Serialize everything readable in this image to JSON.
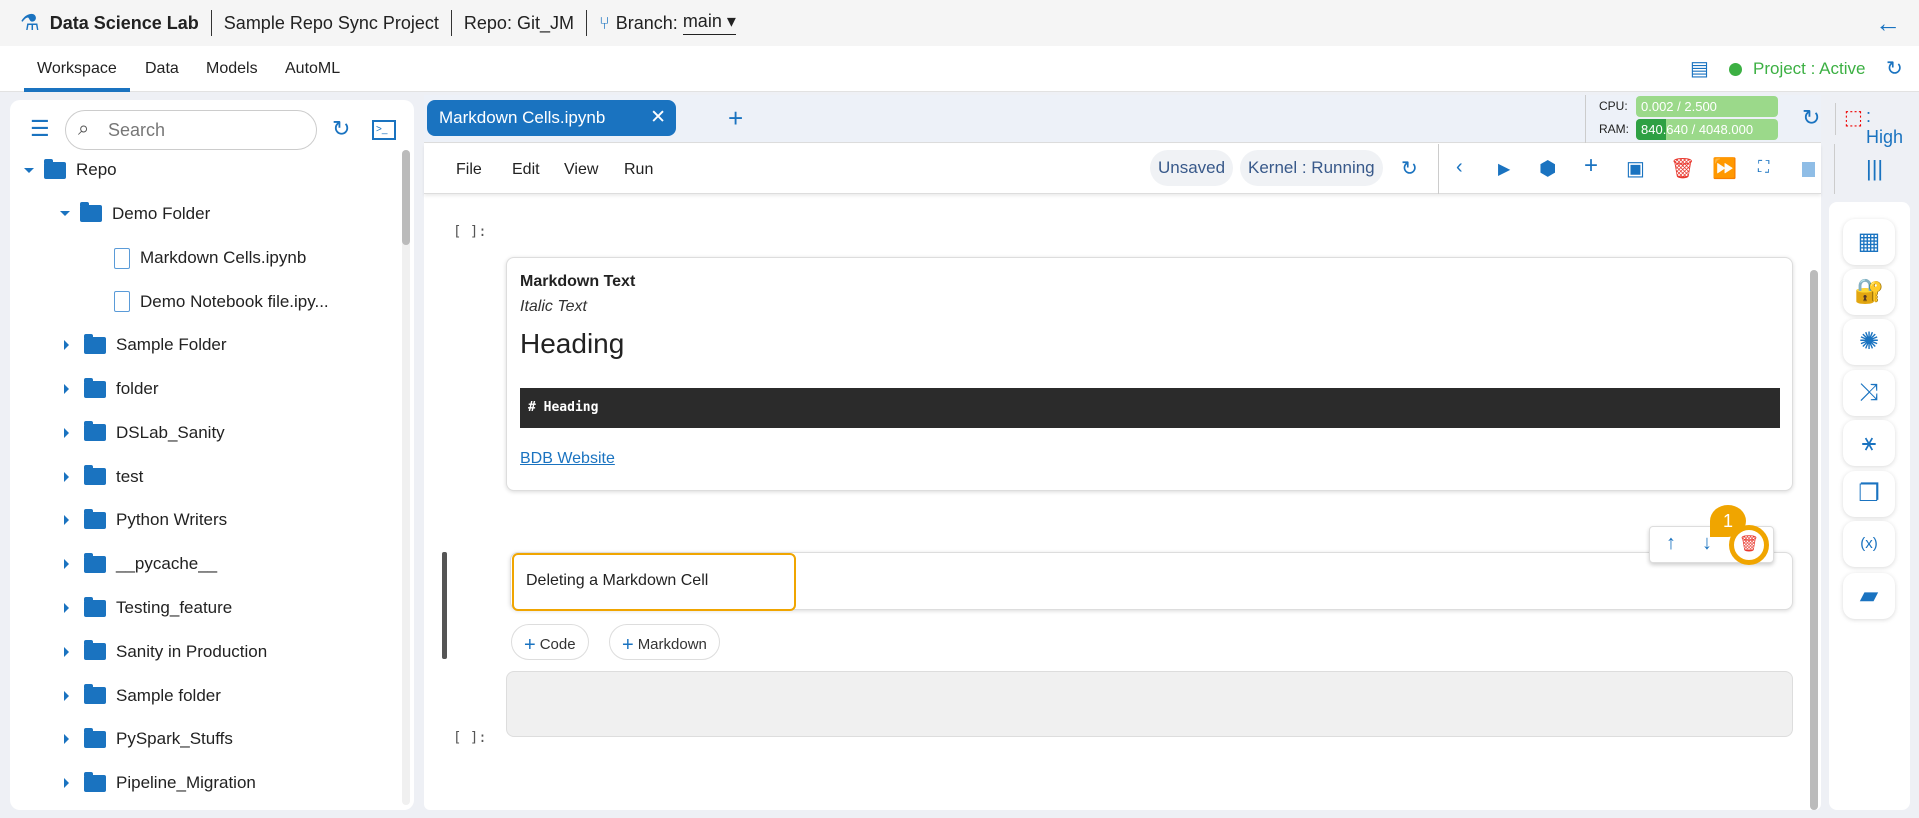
{
  "header": {
    "app": "Data Science Lab",
    "project": "Sample Repo Sync Project",
    "repo": "Repo: Git_JM",
    "branch_label": "Branch:",
    "branch": "main"
  },
  "nav": {
    "tabs": [
      "Workspace",
      "Data",
      "Models",
      "AutoML"
    ],
    "status": "Project : Active"
  },
  "sidebar": {
    "search_placeholder": "Search",
    "tree": [
      {
        "label": "Repo",
        "type": "folder-open",
        "level": 0
      },
      {
        "label": "Demo Folder",
        "type": "folder-open",
        "level": 1
      },
      {
        "label": "Markdown Cells.ipynb",
        "type": "file",
        "level": 2
      },
      {
        "label": "Demo Notebook file.ipy...",
        "type": "file",
        "level": 2
      },
      {
        "label": "Sample Folder",
        "type": "folder",
        "level": 1
      },
      {
        "label": "folder",
        "type": "folder",
        "level": 1
      },
      {
        "label": "DSLab_Sanity",
        "type": "folder",
        "level": 1
      },
      {
        "label": "test",
        "type": "folder",
        "level": 1
      },
      {
        "label": "Python Writers",
        "type": "folder",
        "level": 1
      },
      {
        "label": "__pycache__",
        "type": "folder",
        "level": 1
      },
      {
        "label": "Testing_feature",
        "type": "folder",
        "level": 1
      },
      {
        "label": "Sanity in Production",
        "type": "folder",
        "level": 1
      },
      {
        "label": "Sample folder",
        "type": "folder",
        "level": 1
      },
      {
        "label": "PySpark_Stuffs",
        "type": "folder",
        "level": 1
      },
      {
        "label": "Pipeline_Migration",
        "type": "folder",
        "level": 1
      }
    ]
  },
  "notebook": {
    "tab": "Markdown Cells.ipynb",
    "menu": [
      "File",
      "Edit",
      "View",
      "Run"
    ],
    "saved_status": "Unsaved",
    "kernel": "Kernel : Running",
    "resources": {
      "cpu_label": "CPU:",
      "cpu": "0.002 / 2.500",
      "cpu_fraction": 0.001,
      "ram_label": "RAM:",
      "ram": "840.640 / 4048.000",
      "ram_fraction": 0.21,
      "priority": ": High"
    }
  },
  "cells": {
    "prompt": "[ ]:",
    "md_bold": "Markdown Text",
    "md_italic": "Italic Text",
    "md_heading": "Heading",
    "md_code": "# Heading",
    "md_link": "BDB Website",
    "active_text": "Deleting a Markdown Cell",
    "add_code": "Code",
    "add_markdown": "Markdown",
    "callout": "1"
  },
  "colors": {
    "accent": "#1a73c0",
    "delete": "#e8392f",
    "callout": "#f0a500"
  }
}
